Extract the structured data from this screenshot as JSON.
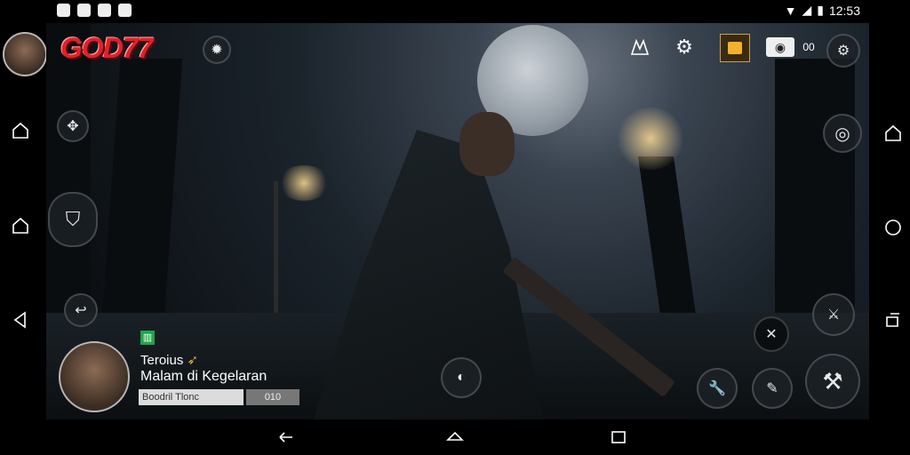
{
  "status": {
    "time": "12:53"
  },
  "hud": {
    "logo": "GOD77",
    "player_tag": "Teroius",
    "mission": "Malam di Kegelaran",
    "progress_left": "Boodril Tlonc",
    "progress_right": "010",
    "top_counter": "00"
  },
  "icons": {
    "top_bar": [
      "map-icon",
      "gear-icon",
      "inventory-chest-icon",
      "eye-camera-icon",
      "settings-cog-icon"
    ],
    "left": [
      "compass-icon",
      "armor-icon",
      "arrow-turn-icon"
    ],
    "right": [
      "target-icon",
      "knife-icon",
      "crossed-swords-icon",
      "wrench-icon",
      "flashlight-icon",
      "torch-icon"
    ]
  }
}
